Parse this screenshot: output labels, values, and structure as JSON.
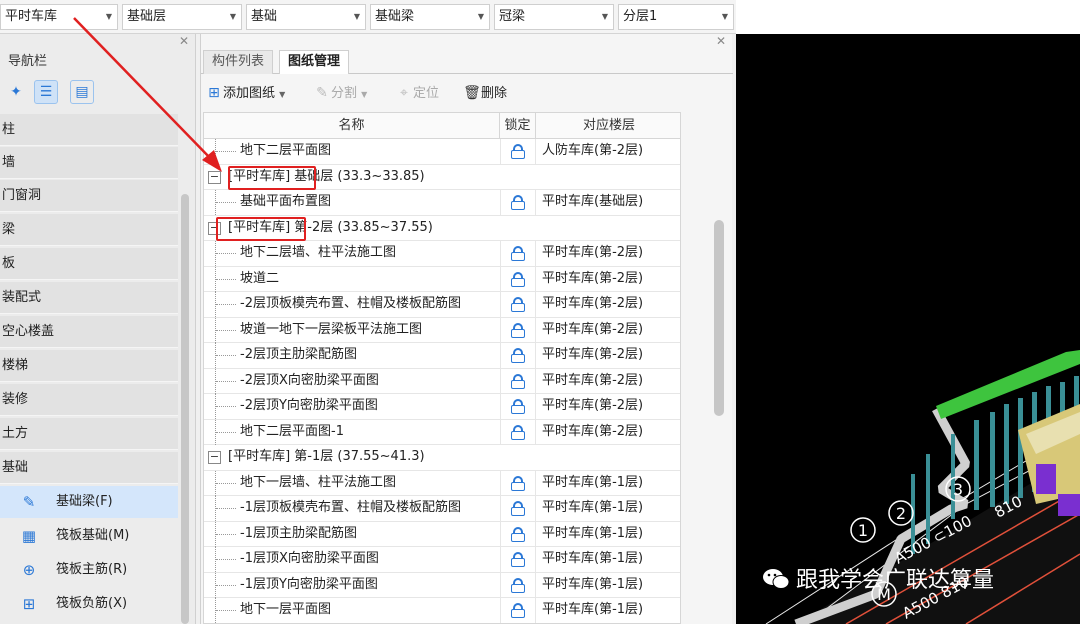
{
  "filters": [
    {
      "label": "平时车库"
    },
    {
      "label": "基础层"
    },
    {
      "label": "基础"
    },
    {
      "label": "基础梁"
    },
    {
      "label": "冠梁"
    },
    {
      "label": "分层1"
    }
  ],
  "nav": {
    "title": "导航栏",
    "categories": [
      "柱",
      "墙",
      "门窗洞",
      "梁",
      "板",
      "装配式",
      "空心楼盖",
      "楼梯",
      "装修",
      "土方",
      "基础"
    ],
    "sub_items": [
      {
        "label": "基础梁(F)",
        "icon": "pencil-icon"
      },
      {
        "label": "筏板基础(M)",
        "icon": "grid-icon"
      },
      {
        "label": "筏板主筋(R)",
        "icon": "rebar-icon"
      },
      {
        "label": "筏板负筋(X)",
        "icon": "neg-rebar-icon"
      }
    ]
  },
  "tabs": [
    "构件列表",
    "图纸管理"
  ],
  "toolbar": {
    "add": "添加图纸",
    "split": "分割",
    "locate": "定位",
    "delete": "删除"
  },
  "table": {
    "headers": {
      "name": "名称",
      "lock": "锁定",
      "floor": "对应楼层"
    },
    "rows": [
      {
        "type": "item",
        "name": "地下二层平面图",
        "floor": "人防车库(第-2层)"
      },
      {
        "type": "group",
        "name": "[平时车库] 基础层 (33.3~33.85)"
      },
      {
        "type": "item",
        "name": "基础平面布置图",
        "floor": "平时车库(基础层)"
      },
      {
        "type": "group",
        "name": "[平时车库] 第-2层 (33.85~37.55)"
      },
      {
        "type": "item",
        "name": "地下二层墙、柱平法施工图",
        "floor": "平时车库(第-2层)"
      },
      {
        "type": "item",
        "name": "坡道二",
        "floor": "平时车库(第-2层)"
      },
      {
        "type": "item",
        "name": "-2层顶板模壳布置、柱帽及楼板配筋图",
        "floor": "平时车库(第-2层)"
      },
      {
        "type": "item",
        "name": "坡道一地下一层梁板平法施工图",
        "floor": "平时车库(第-2层)"
      },
      {
        "type": "item",
        "name": "-2层顶主肋梁配筋图",
        "floor": "平时车库(第-2层)"
      },
      {
        "type": "item",
        "name": "-2层顶X向密肋梁平面图",
        "floor": "平时车库(第-2层)"
      },
      {
        "type": "item",
        "name": "-2层顶Y向密肋梁平面图",
        "floor": "平时车库(第-2层)"
      },
      {
        "type": "item",
        "name": "地下二层平面图-1",
        "floor": "平时车库(第-2层)"
      },
      {
        "type": "group",
        "name": "[平时车库] 第-1层 (37.55~41.3)"
      },
      {
        "type": "item",
        "name": "地下一层墙、柱平法施工图",
        "floor": "平时车库(第-1层)"
      },
      {
        "type": "item",
        "name": "-1层顶板模壳布置、柱帽及楼板配筋图",
        "floor": "平时车库(第-1层)"
      },
      {
        "type": "item",
        "name": "-1层顶主肋梁配筋图",
        "floor": "平时车库(第-1层)"
      },
      {
        "type": "item",
        "name": "-1层顶X向密肋梁平面图",
        "floor": "平时车库(第-1层)"
      },
      {
        "type": "item",
        "name": "-1层顶Y向密肋梁平面图",
        "floor": "平时车库(第-1层)"
      },
      {
        "type": "item",
        "name": "地下一层平面图",
        "floor": "平时车库(第-1层)"
      }
    ]
  },
  "viewport": {
    "labels": [
      "1",
      "2",
      "3",
      "M",
      "A500 ⊂100",
      "810",
      "A500 810"
    ]
  },
  "watermark": "跟我学会广联达算量",
  "colors": {
    "accent": "#2b78d6",
    "annotation": "#e02020",
    "green": "#3ec43e",
    "purple": "#7a2fd0"
  }
}
